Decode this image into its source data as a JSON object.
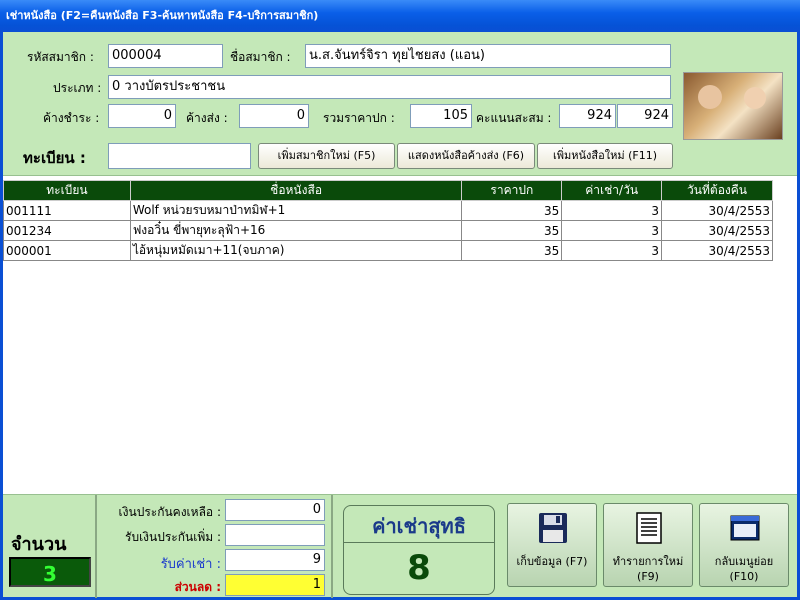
{
  "window": {
    "title": "เช่าหนังสือ (F2=คืนหนังสือ   F3-ค้นหาหนังสือ   F4-บริการสมาชิก)"
  },
  "member": {
    "id_label": "รหัสสมาชิก :",
    "id_value": "000004",
    "name_label": "ชื่อสมาชิก :",
    "name_value": "น.ส.จันทร์จิรา ทุยไชยสง (แอน)",
    "type_label": "ประเภท :",
    "type_value": "0 วางบัตรประชาชน",
    "overdue_pay_label": "ค้างชำระ :",
    "overdue_pay_value": "0",
    "overdue_return_label": "ค้างส่ง :",
    "overdue_return_value": "0",
    "total_price_label": "รวมราคาปก :",
    "total_price_value": "105",
    "points_label": "คะแนนสะสม :",
    "points_value_1": "924",
    "points_value_2": "924"
  },
  "register": {
    "label": "ทะเบียน :",
    "value": ""
  },
  "buttons": {
    "add_member": "เพิ่มสมาชิกใหม่ (F5)",
    "show_overdue": "แสดงหนังสือค้างส่ง (F6)",
    "add_book": "เพิ่มหนังสือใหม่ (F11)"
  },
  "table": {
    "headers": [
      "ทะเบียน",
      "ชื่อหนังสือ",
      "ราคาปก",
      "ค่าเช่า/วัน",
      "วันที่ต้องคืน"
    ],
    "rows": [
      [
        "001111",
        "Wolf หน่วยรบหมาป่าทมิฬ+1",
        "35",
        "3",
        "30/4/2553"
      ],
      [
        "001234",
        "ฟงอวิ๋น ขี่พายุทะลุฟ้า+16",
        "35",
        "3",
        "30/4/2553"
      ],
      [
        "000001",
        "ไอ้หนุ่มหมัดเมา+11(จบภาค)",
        "35",
        "3",
        "30/4/2553"
      ]
    ]
  },
  "summary": {
    "qty_label": "จำนวน",
    "qty_value": "3",
    "deposit_left_label": "เงินประกันคงเหลือ :",
    "deposit_left_value": "0",
    "deposit_add_label": "รับเงินประกันเพิ่ม :",
    "deposit_add_value": "",
    "rent_label": "รับค่าเช่า :",
    "rent_value": "9",
    "discount_label": "ส่วนลด :",
    "discount_value": "1",
    "net_label": "ค่าเช่าสุทธิ",
    "net_value": "8"
  },
  "bottom_buttons": {
    "save": "เก็บข้อมูล (F7)",
    "new_list": "ทำรายการใหม่ (F9)",
    "back_menu": "กลับเมนูย่อย (F10)"
  },
  "colors": {
    "panel": "#c4e8b8",
    "header": "#0a4a0a",
    "qty_text": "#33ff33",
    "rent_label": "#1a3acc",
    "discount_label": "#cc0000",
    "discount_field": "#ffff33"
  }
}
